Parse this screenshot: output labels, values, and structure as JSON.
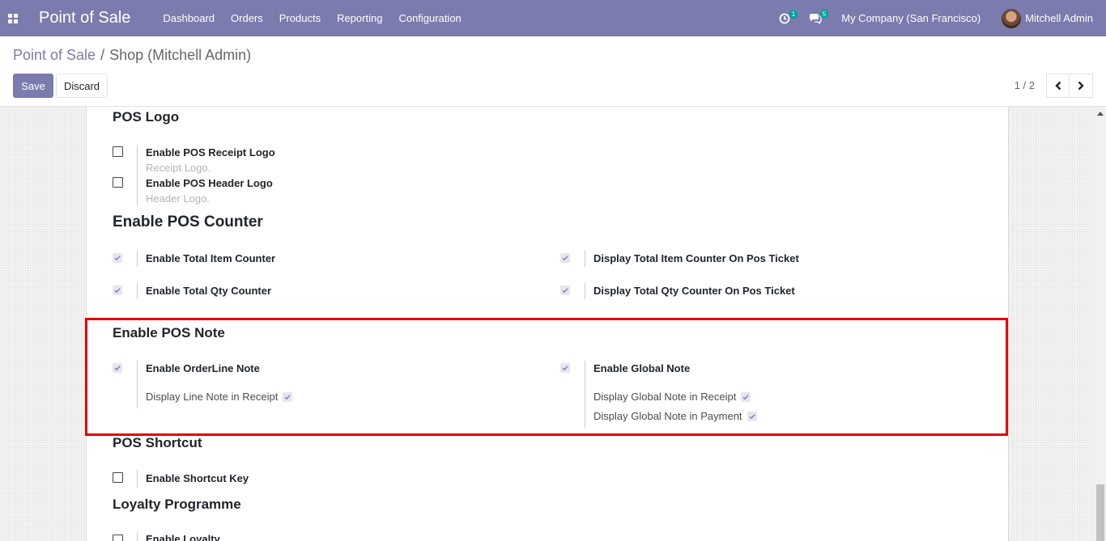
{
  "navbar": {
    "brand": "Point of Sale",
    "menu": [
      "Dashboard",
      "Orders",
      "Products",
      "Reporting",
      "Configuration"
    ],
    "activity_count": "1",
    "messages_count": "5",
    "company": "My Company (San Francisco)",
    "user": "Mitchell Admin"
  },
  "breadcrumb": {
    "parent": "Point of Sale",
    "separator": "/",
    "current": "Shop (Mitchell Admin)"
  },
  "buttons": {
    "save": "Save",
    "discard": "Discard"
  },
  "pager": {
    "value": "1 / 2"
  },
  "sections": {
    "pos_logo": {
      "title": "POS Logo",
      "receipt_logo": {
        "label": "Enable POS Receipt Logo",
        "hint": "Receipt Logo.",
        "checked": false
      },
      "header_logo": {
        "label": "Enable POS Header Logo",
        "hint": "Header Logo.",
        "checked": false
      }
    },
    "pos_counter": {
      "title": "Enable POS Counter",
      "total_item": {
        "label": "Enable Total Item Counter",
        "checked": true
      },
      "total_qty": {
        "label": "Enable Total Qty Counter",
        "checked": true
      },
      "display_item_ticket": {
        "label": "Display Total Item Counter On Pos Ticket",
        "checked": true
      },
      "display_qty_ticket": {
        "label": "Display Total Qty Counter On Pos Ticket",
        "checked": true
      }
    },
    "pos_note": {
      "title": "Enable POS Note",
      "orderline_note": {
        "label": "Enable OrderLine Note",
        "checked": true,
        "sub": "Display Line Note in Receipt"
      },
      "global_note": {
        "label": "Enable Global Note",
        "checked": true,
        "sub_receipt": "Display Global Note in Receipt",
        "sub_payment": "Display Global Note in Payment"
      }
    },
    "pos_shortcut": {
      "title": "POS Shortcut",
      "shortcut_key": {
        "label": "Enable Shortcut Key",
        "checked": false
      }
    },
    "loyalty": {
      "title": "Loyalty Programme",
      "enable_loyalty": {
        "label": "Enable Loyalty",
        "checked": false
      }
    }
  },
  "colors": {
    "navbar": "#7c7bad",
    "highlight": "#e60000",
    "accent": "#7c7bad"
  }
}
